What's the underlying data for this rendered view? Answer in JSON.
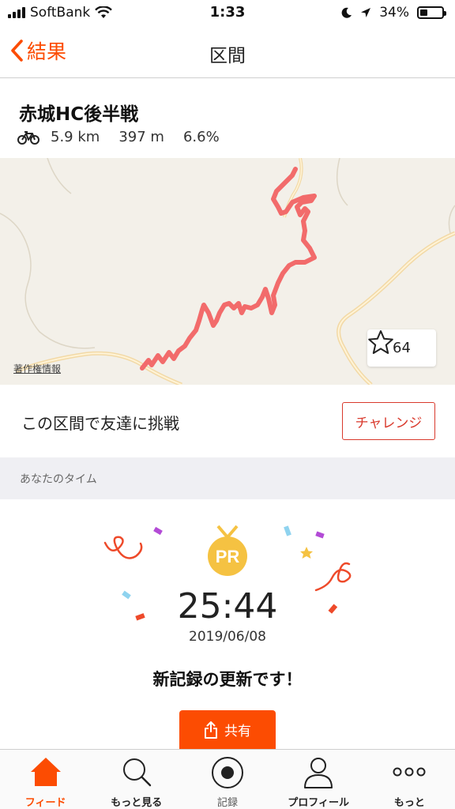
{
  "status_bar": {
    "carrier": "SoftBank",
    "time": "1:33",
    "battery": "34%",
    "battery_level": 0.34
  },
  "nav": {
    "back_label": "結果",
    "title": "区間"
  },
  "segment": {
    "name": "赤城HC後半戦",
    "distance": "5.9 km",
    "elevation": "397 m",
    "grade": "6.6%"
  },
  "map": {
    "attribution": "著作権情報",
    "star_count": "64",
    "route_color": "#f26b6b"
  },
  "challenge": {
    "text": "この区間で友達に挑戦",
    "button_label": "チャレンジ"
  },
  "section": {
    "title": "あなたのタイム"
  },
  "result": {
    "medal_label": "PR",
    "time": "25:44",
    "date": "2019/06/08",
    "message": "新記録の更新です！",
    "share_label": "共有"
  },
  "tabs": [
    {
      "label": "フィード",
      "icon": "home-icon",
      "active": true
    },
    {
      "label": "もっと見る",
      "icon": "search-icon",
      "active": false
    },
    {
      "label": "記録",
      "icon": "record-icon",
      "active": false
    },
    {
      "label": "プロフィール",
      "icon": "profile-icon",
      "active": false
    },
    {
      "label": "もっと",
      "icon": "more-icon",
      "active": false
    }
  ],
  "colors": {
    "accent": "#fc4c02",
    "challenge_red": "#d9392c",
    "medal_gold": "#f5c242"
  }
}
